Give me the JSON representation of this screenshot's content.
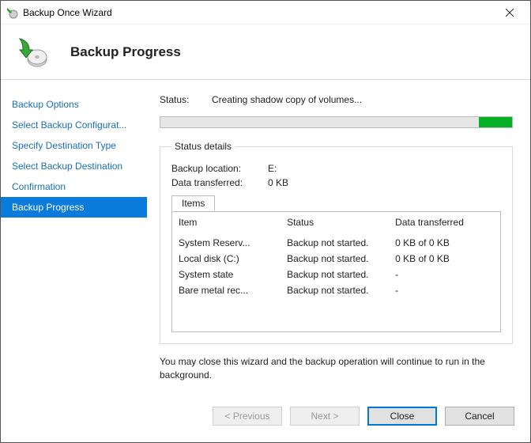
{
  "window": {
    "title": "Backup Once Wizard"
  },
  "header": {
    "title": "Backup Progress"
  },
  "sidebar": {
    "items": [
      {
        "label": "Backup Options"
      },
      {
        "label": "Select Backup Configurat..."
      },
      {
        "label": "Specify Destination Type"
      },
      {
        "label": "Select Backup Destination"
      },
      {
        "label": "Confirmation"
      },
      {
        "label": "Backup Progress"
      }
    ],
    "activeIndex": 5
  },
  "status": {
    "label": "Status:",
    "value": "Creating shadow copy of volumes..."
  },
  "details": {
    "legend": "Status details",
    "location_label": "Backup location:",
    "location_value": "E:",
    "transferred_label": "Data transferred:",
    "transferred_value": "0 KB",
    "tab_label": "Items",
    "columns": {
      "item": "Item",
      "status": "Status",
      "transferred": "Data transferred"
    },
    "rows": [
      {
        "item": "System Reserv...",
        "status": "Backup not started.",
        "transferred": "0 KB of 0 KB"
      },
      {
        "item": "Local disk (C:)",
        "status": "Backup not started.",
        "transferred": "0 KB of 0 KB"
      },
      {
        "item": "System state",
        "status": "Backup not started.",
        "transferred": "-"
      },
      {
        "item": "Bare metal rec...",
        "status": "Backup not started.",
        "transferred": "-"
      }
    ]
  },
  "note": "You may close this wizard and the backup operation will continue to run in the background.",
  "buttons": {
    "previous": "< Previous",
    "next": "Next >",
    "close": "Close",
    "cancel": "Cancel"
  },
  "colors": {
    "accent": "#0078d7",
    "progress": "#06b025"
  }
}
